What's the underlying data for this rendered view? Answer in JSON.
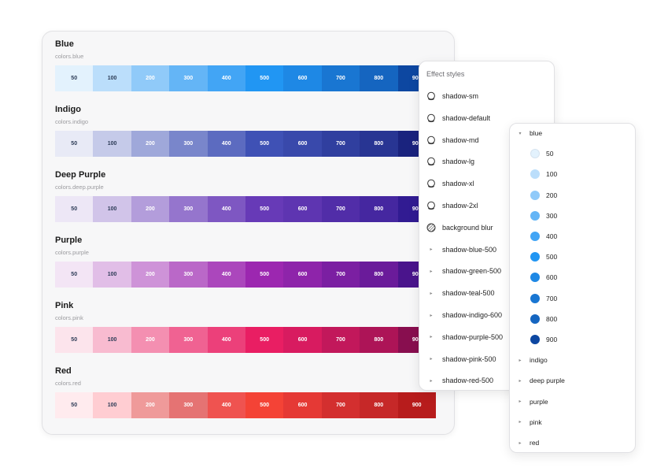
{
  "palette": {
    "groups": [
      {
        "title": "Blue",
        "token": "colors.blue",
        "swatches": [
          {
            "label": "50",
            "color": "#e3f2fd",
            "text_color": "#2b3a55"
          },
          {
            "label": "100",
            "color": "#bbdefb",
            "text_color": "#2b3a55"
          },
          {
            "label": "200",
            "color": "#90caf9",
            "text_color": "#ffffff"
          },
          {
            "label": "300",
            "color": "#64b5f6",
            "text_color": "#ffffff"
          },
          {
            "label": "400",
            "color": "#42a5f5",
            "text_color": "#ffffff"
          },
          {
            "label": "500",
            "color": "#2196f3",
            "text_color": "#ffffff"
          },
          {
            "label": "600",
            "color": "#1e88e5",
            "text_color": "#ffffff"
          },
          {
            "label": "700",
            "color": "#1976d2",
            "text_color": "#ffffff"
          },
          {
            "label": "800",
            "color": "#1565c0",
            "text_color": "#ffffff"
          },
          {
            "label": "900",
            "color": "#0d47a1",
            "text_color": "#ffffff"
          }
        ]
      },
      {
        "title": "Indigo",
        "token": "colors.indigo",
        "swatches": [
          {
            "label": "50",
            "color": "#e8eaf6",
            "text_color": "#2b3a55"
          },
          {
            "label": "100",
            "color": "#c5cae9",
            "text_color": "#2b3a55"
          },
          {
            "label": "200",
            "color": "#9fa8da",
            "text_color": "#ffffff"
          },
          {
            "label": "300",
            "color": "#7986cb",
            "text_color": "#ffffff"
          },
          {
            "label": "400",
            "color": "#5c6bc0",
            "text_color": "#ffffff"
          },
          {
            "label": "500",
            "color": "#3f51b5",
            "text_color": "#ffffff"
          },
          {
            "label": "600",
            "color": "#3949ab",
            "text_color": "#ffffff"
          },
          {
            "label": "700",
            "color": "#303f9f",
            "text_color": "#ffffff"
          },
          {
            "label": "800",
            "color": "#283593",
            "text_color": "#ffffff"
          },
          {
            "label": "900",
            "color": "#1a237e",
            "text_color": "#ffffff"
          }
        ]
      },
      {
        "title": "Deep Purple",
        "token": "colors.deep.purple",
        "swatches": [
          {
            "label": "50",
            "color": "#ede7f6",
            "text_color": "#2b3a55"
          },
          {
            "label": "100",
            "color": "#d1c4e9",
            "text_color": "#2b3a55"
          },
          {
            "label": "200",
            "color": "#b39ddb",
            "text_color": "#ffffff"
          },
          {
            "label": "300",
            "color": "#9575cd",
            "text_color": "#ffffff"
          },
          {
            "label": "400",
            "color": "#7e57c2",
            "text_color": "#ffffff"
          },
          {
            "label": "500",
            "color": "#673ab7",
            "text_color": "#ffffff"
          },
          {
            "label": "600",
            "color": "#5e35b1",
            "text_color": "#ffffff"
          },
          {
            "label": "700",
            "color": "#512da8",
            "text_color": "#ffffff"
          },
          {
            "label": "800",
            "color": "#4527a0",
            "text_color": "#ffffff"
          },
          {
            "label": "900",
            "color": "#311b92",
            "text_color": "#ffffff"
          }
        ]
      },
      {
        "title": "Purple",
        "token": "colors.purple",
        "swatches": [
          {
            "label": "50",
            "color": "#f3e5f5",
            "text_color": "#2b3a55"
          },
          {
            "label": "100",
            "color": "#e1bee7",
            "text_color": "#2b3a55"
          },
          {
            "label": "200",
            "color": "#ce93d8",
            "text_color": "#ffffff"
          },
          {
            "label": "300",
            "color": "#ba68c8",
            "text_color": "#ffffff"
          },
          {
            "label": "400",
            "color": "#ab47bc",
            "text_color": "#ffffff"
          },
          {
            "label": "500",
            "color": "#9c27b0",
            "text_color": "#ffffff"
          },
          {
            "label": "600",
            "color": "#8e24aa",
            "text_color": "#ffffff"
          },
          {
            "label": "700",
            "color": "#7b1fa2",
            "text_color": "#ffffff"
          },
          {
            "label": "800",
            "color": "#6a1b9a",
            "text_color": "#ffffff"
          },
          {
            "label": "900",
            "color": "#4a148c",
            "text_color": "#ffffff"
          }
        ]
      },
      {
        "title": "Pink",
        "token": "colors.pink",
        "swatches": [
          {
            "label": "50",
            "color": "#fce4ec",
            "text_color": "#2b3a55"
          },
          {
            "label": "100",
            "color": "#f8bbd0",
            "text_color": "#2b3a55"
          },
          {
            "label": "200",
            "color": "#f48fb1",
            "text_color": "#ffffff"
          },
          {
            "label": "300",
            "color": "#f06292",
            "text_color": "#ffffff"
          },
          {
            "label": "400",
            "color": "#ec407a",
            "text_color": "#ffffff"
          },
          {
            "label": "500",
            "color": "#e91e63",
            "text_color": "#ffffff"
          },
          {
            "label": "600",
            "color": "#d81b60",
            "text_color": "#ffffff"
          },
          {
            "label": "700",
            "color": "#c2185b",
            "text_color": "#ffffff"
          },
          {
            "label": "800",
            "color": "#ad1457",
            "text_color": "#ffffff"
          },
          {
            "label": "900",
            "color": "#880e4f",
            "text_color": "#ffffff"
          }
        ]
      },
      {
        "title": "Red",
        "token": "colors.red",
        "swatches": [
          {
            "label": "50",
            "color": "#ffebee",
            "text_color": "#2b3a55"
          },
          {
            "label": "100",
            "color": "#ffcdd2",
            "text_color": "#2b3a55"
          },
          {
            "label": "200",
            "color": "#ef9a9a",
            "text_color": "#ffffff"
          },
          {
            "label": "300",
            "color": "#e57373",
            "text_color": "#ffffff"
          },
          {
            "label": "400",
            "color": "#ef5350",
            "text_color": "#ffffff"
          },
          {
            "label": "500",
            "color": "#f44336",
            "text_color": "#ffffff"
          },
          {
            "label": "600",
            "color": "#e53935",
            "text_color": "#ffffff"
          },
          {
            "label": "700",
            "color": "#d32f2f",
            "text_color": "#ffffff"
          },
          {
            "label": "800",
            "color": "#c62828",
            "text_color": "#ffffff"
          },
          {
            "label": "900",
            "color": "#b71c1c",
            "text_color": "#ffffff"
          }
        ]
      }
    ]
  },
  "effect_styles": {
    "header": "Effect styles",
    "items": [
      {
        "label": "shadow-sm",
        "icon": "drop-shadow-icon",
        "kind": "style"
      },
      {
        "label": "shadow-default",
        "icon": "drop-shadow-icon",
        "kind": "style"
      },
      {
        "label": "shadow-md",
        "icon": "drop-shadow-icon",
        "kind": "style"
      },
      {
        "label": "shadow-lg",
        "icon": "drop-shadow-icon",
        "kind": "style"
      },
      {
        "label": "shadow-xl",
        "icon": "drop-shadow-icon",
        "kind": "style"
      },
      {
        "label": "shadow-2xl",
        "icon": "drop-shadow-icon",
        "kind": "style"
      },
      {
        "label": "background blur",
        "icon": "background-blur-icon",
        "kind": "style"
      },
      {
        "label": "shadow-blue-500",
        "icon": "caret-right-icon",
        "kind": "group"
      },
      {
        "label": "shadow-green-500",
        "icon": "caret-right-icon",
        "kind": "group"
      },
      {
        "label": "shadow-teal-500",
        "icon": "caret-right-icon",
        "kind": "group"
      },
      {
        "label": "shadow-indigo-600",
        "icon": "caret-right-icon",
        "kind": "group"
      },
      {
        "label": "shadow-purple-500",
        "icon": "caret-right-icon",
        "kind": "group"
      },
      {
        "label": "shadow-pink-500",
        "icon": "caret-right-icon",
        "kind": "group"
      },
      {
        "label": "shadow-red-500",
        "icon": "caret-right-icon",
        "kind": "group"
      }
    ]
  },
  "color_styles": {
    "expanded_group": {
      "label": "blue",
      "icon": "caret-down-icon",
      "items": [
        {
          "label": "50",
          "color": "#e3f2fd"
        },
        {
          "label": "100",
          "color": "#bbdefb"
        },
        {
          "label": "200",
          "color": "#90caf9"
        },
        {
          "label": "300",
          "color": "#64b5f6"
        },
        {
          "label": "400",
          "color": "#42a5f5"
        },
        {
          "label": "500",
          "color": "#2196f3"
        },
        {
          "label": "600",
          "color": "#1e88e5"
        },
        {
          "label": "700",
          "color": "#1976d2"
        },
        {
          "label": "800",
          "color": "#1565c0"
        },
        {
          "label": "900",
          "color": "#0d47a1"
        }
      ]
    },
    "collapsed_groups": [
      {
        "label": "indigo",
        "icon": "caret-right-icon"
      },
      {
        "label": "deep purple",
        "icon": "caret-right-icon"
      },
      {
        "label": "purple",
        "icon": "caret-right-icon"
      },
      {
        "label": "pink",
        "icon": "caret-right-icon"
      },
      {
        "label": "red",
        "icon": "caret-right-icon"
      }
    ]
  }
}
